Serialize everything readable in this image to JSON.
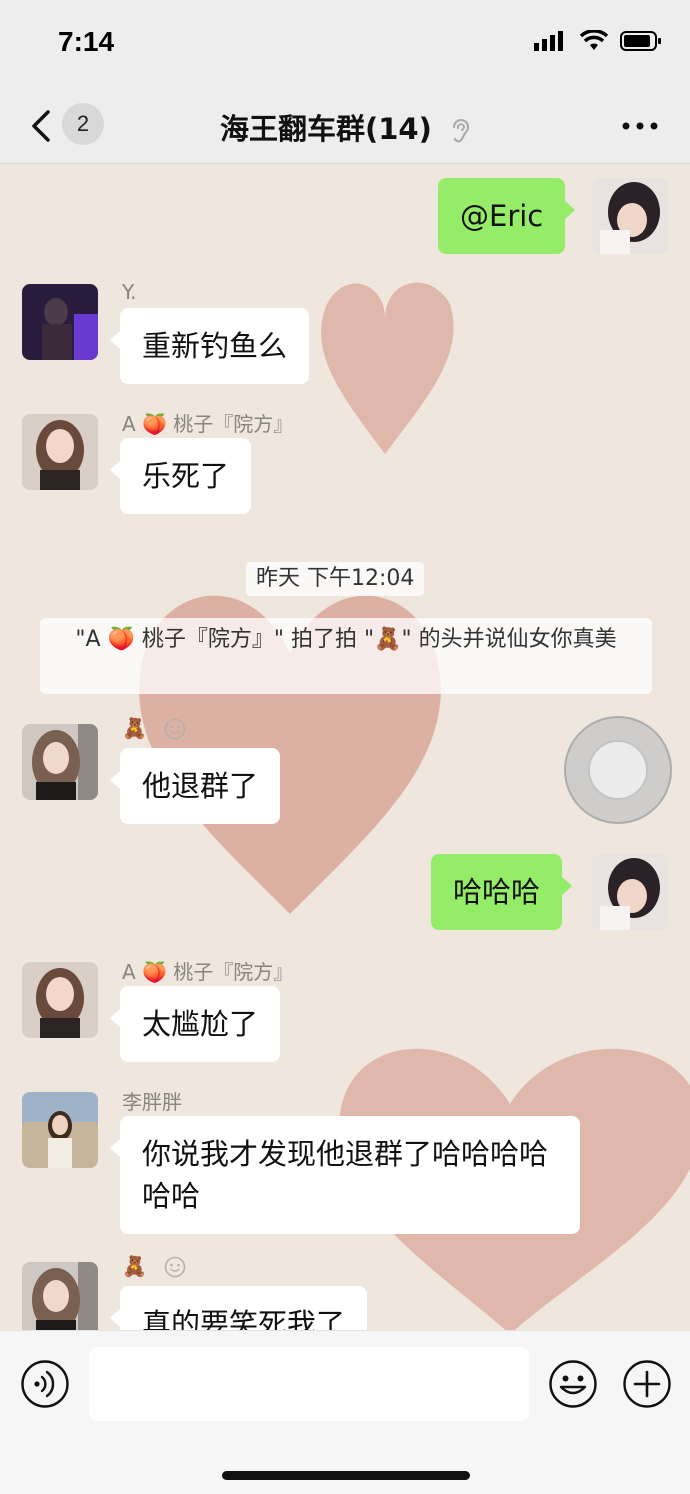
{
  "status_bar": {
    "time": "7:14"
  },
  "nav": {
    "unread_count": "2",
    "title": "海王翻车群(14)"
  },
  "messages": {
    "m1": {
      "text": "@Eric"
    },
    "m2": {
      "sender": "Y.",
      "text": "重新钓鱼么"
    },
    "m3": {
      "sender": "A 🍑 桃子『院方』",
      "text": "乐死了"
    },
    "timestamp": "昨天 下午12:04",
    "system": "\"A 🍑 桃子『院方』\" 拍了拍 \"🧸\" 的头并说仙女你真美",
    "m4": {
      "sender": "🧸",
      "text": "他退群了"
    },
    "m5": {
      "text": "哈哈哈"
    },
    "m6": {
      "sender": "A 🍑 桃子『院方』",
      "text": "太尴尬了"
    },
    "m7": {
      "sender": "李胖胖",
      "text": "你说我才发现他退群了哈哈哈哈哈哈"
    },
    "m8": {
      "sender": "🧸",
      "text": "真的要笑死我了"
    }
  },
  "input": {
    "placeholder": ""
  },
  "colors": {
    "bubble_sent": "#95ec69",
    "bubble_received": "#ffffff",
    "background": "#efe6dd"
  }
}
